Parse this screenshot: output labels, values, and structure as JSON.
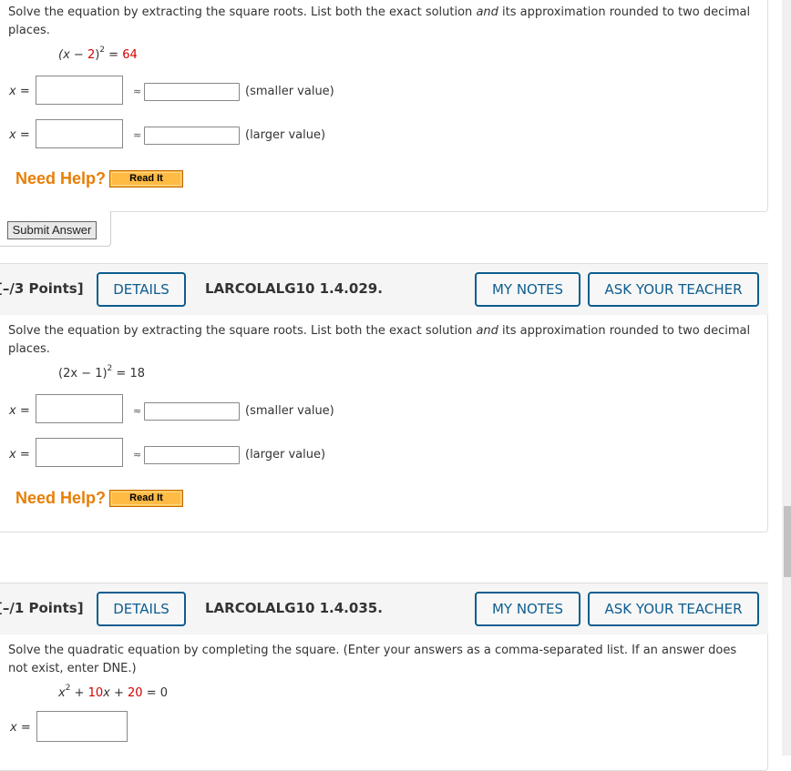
{
  "question1": {
    "prompt_line1": "Solve the equation by extracting the square roots. List both the exact solution ",
    "prompt_and": "and",
    "prompt_line1_end": " its approximation rounded to two decimal",
    "prompt_line2": "places.",
    "equation": {
      "open": "(x − ",
      "const": "2",
      "close": ")",
      "exp": "2",
      "eq": " = ",
      "rhs": "64"
    },
    "rows": [
      {
        "label": "x =",
        "exact_value": "",
        "approx_symbol": "≈",
        "approx_value": "",
        "hint": "(smaller value)"
      },
      {
        "label": "x =",
        "exact_value": "",
        "approx_symbol": "≈",
        "approx_value": "",
        "hint": "(larger value)"
      }
    ],
    "need_help": "Need Help?",
    "read_it": "Read It",
    "submit": "Submit Answer"
  },
  "question2": {
    "points": "[–/3 Points]",
    "details": "DETAILS",
    "id": "LARCOLALG10 1.4.029.",
    "my_notes": "MY NOTES",
    "ask_teacher": "ASK YOUR TEACHER",
    "prompt_line1": "Solve the equation by extracting the square roots. List both the exact solution ",
    "prompt_and": "and",
    "prompt_line1_end": " its approximation rounded to two decimal",
    "prompt_line2": "places.",
    "equation": {
      "open": "(2x − 1)",
      "exp": "2",
      "eq": " = 18"
    },
    "rows": [
      {
        "label": "x =",
        "exact_value": "",
        "approx_symbol": "≈",
        "approx_value": "",
        "hint": "(smaller value)"
      },
      {
        "label": "x =",
        "exact_value": "",
        "approx_symbol": "≈",
        "approx_value": "",
        "hint": "(larger value)"
      }
    ],
    "need_help": "Need Help?",
    "read_it": "Read It"
  },
  "question3": {
    "points": "[–/1 Points]",
    "details": "DETAILS",
    "id": "LARCOLALG10 1.4.035.",
    "my_notes": "MY NOTES",
    "ask_teacher": "ASK YOUR TEACHER",
    "prompt_line1": "Solve the quadratic equation by completing the square. (Enter your answers as a comma-separated list. If an answer does",
    "prompt_line2": "not exist, enter DNE.)",
    "equation": {
      "x": "x",
      "exp": "2",
      "plus1": " + ",
      "b": "10",
      "bx": "x",
      "plus2": " + ",
      "c": "20",
      "rhs": " = 0"
    },
    "row": {
      "label": "x =",
      "value": ""
    }
  },
  "colors": {
    "accent": "#0d5d8f",
    "help": "#e87e04",
    "coef": "#d40000",
    "read_it_bg": "#ffbb44"
  }
}
